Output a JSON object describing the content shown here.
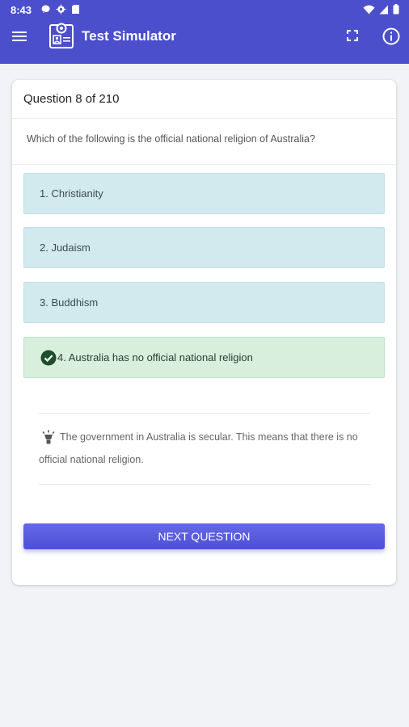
{
  "status_bar": {
    "time": "8:43",
    "left_icons": [
      "message-icon",
      "gear-icon",
      "sd-card-icon"
    ],
    "right_icons": [
      "wifi-icon",
      "signal-icon",
      "battery-icon"
    ]
  },
  "app_bar": {
    "title": "Test Simulator",
    "color": "#4c4fcc"
  },
  "quiz": {
    "counter": "Question 8 of 210",
    "question": "Which of the following is the official national religion of Australia?",
    "answers": [
      {
        "label": "1. Christianity",
        "state": "neutral"
      },
      {
        "label": "2. Judaism",
        "state": "neutral"
      },
      {
        "label": "3. Buddhism",
        "state": "neutral"
      },
      {
        "label": "4. Australia has no official national religion",
        "state": "correct"
      }
    ],
    "explanation": "The government in Australia is secular. This means that there is no official national religion.",
    "next_button": "NEXT QUESTION"
  },
  "colors": {
    "answer_neutral": "#d2eaee",
    "answer_correct": "#d7efdc",
    "check": "#1e4d2b"
  }
}
